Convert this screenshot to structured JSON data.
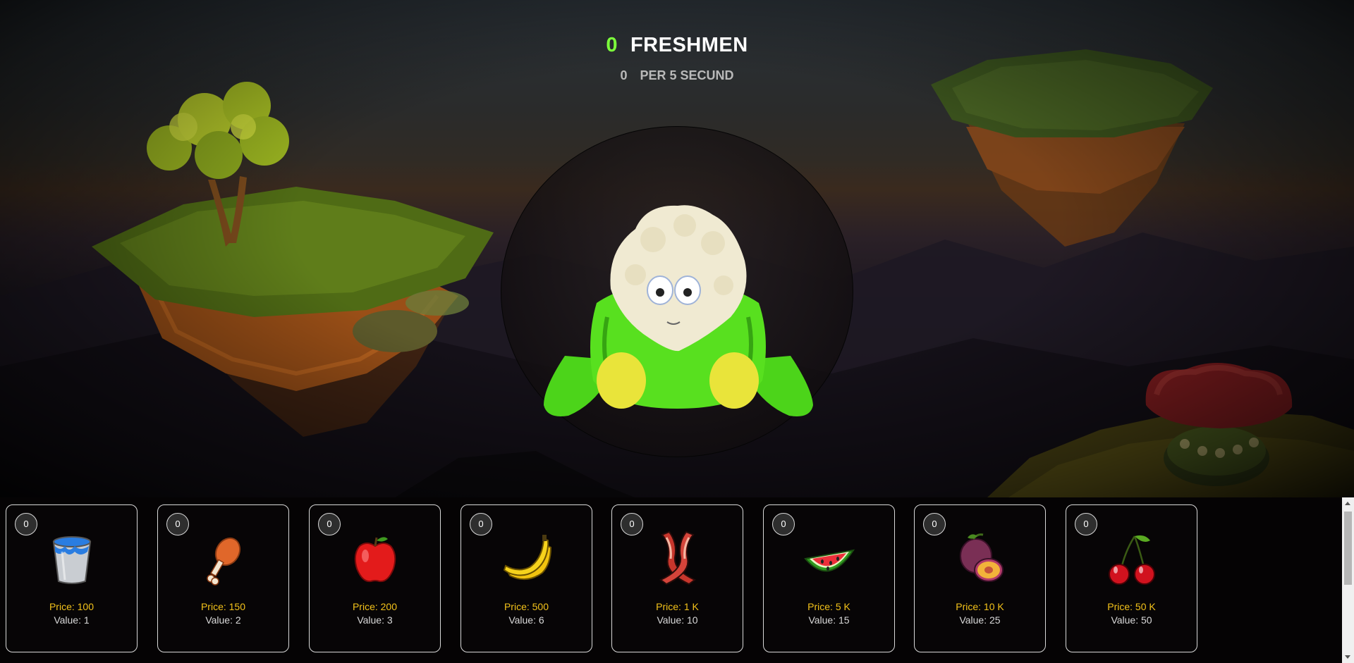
{
  "header": {
    "score": "0",
    "score_label": "FRESHMEN",
    "rate": "0",
    "rate_label": "PER 5 SECUND"
  },
  "colors": {
    "score_accent": "#7cff3b",
    "price_text": "#f3c21a",
    "card_border": "#d8d8d8"
  },
  "clicker": {
    "icon": "cauliflower-plush-icon"
  },
  "shop": {
    "items": [
      {
        "icon": "water-bucket-icon",
        "count": "0",
        "price": "Price: 100",
        "value": "Value: 1"
      },
      {
        "icon": "chicken-leg-icon",
        "count": "0",
        "price": "Price: 150",
        "value": "Value: 2"
      },
      {
        "icon": "apple-icon",
        "count": "0",
        "price": "Price: 200",
        "value": "Value: 3"
      },
      {
        "icon": "banana-icon",
        "count": "0",
        "price": "Price: 500",
        "value": "Value: 6"
      },
      {
        "icon": "bacon-icon",
        "count": "0",
        "price": "Price: 1 K",
        "value": "Value: 10"
      },
      {
        "icon": "watermelon-icon",
        "count": "0",
        "price": "Price: 5 K",
        "value": "Value: 15"
      },
      {
        "icon": "plum-icon",
        "count": "0",
        "price": "Price: 10 K",
        "value": "Value: 25"
      },
      {
        "icon": "cherry-icon",
        "count": "0",
        "price": "Price: 50 K",
        "value": "Value: 50"
      }
    ]
  }
}
